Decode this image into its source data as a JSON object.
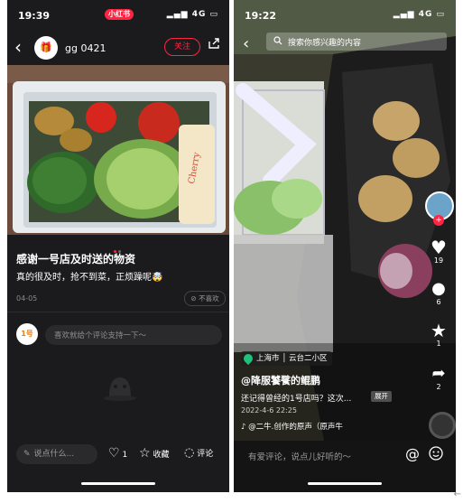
{
  "left": {
    "status_time": "19:39",
    "status_signal": "4G",
    "app_badge": "小红书",
    "username": "gg 0421",
    "follow_label": "关注",
    "post_title": "感谢一号店及时送的物资",
    "post_desc": "真的很及时，抢不到菜，正烦躁呢🤯",
    "post_date": "04-05",
    "dislike_label": "不喜欢",
    "comment_placeholder": "喜欢就给个评论支持一下～",
    "say_placeholder": "说点什么...",
    "like_count": "1",
    "collect_label": "收藏",
    "comment_label": "评论"
  },
  "right": {
    "status_time": "19:22",
    "status_signal": "4G",
    "search_placeholder": "搜索你感兴趣的内容",
    "likes": "19",
    "comments": "6",
    "favorites": "1",
    "shares": "2",
    "location": "上海市 │ 云台二小区",
    "author": "@降服饕餮的鲲鹏",
    "description": "还记得曾经的1号店吗？这次...",
    "expand_label": "展开",
    "date": "2022-4-6 22:25",
    "music": "@二牛.创作的原声（原声牛",
    "comment_placeholder": "有爱评论，说点儿好听的～",
    "at_symbol": "@"
  },
  "colors": {
    "accent": "#ff2442",
    "dark_bg": "#1b1b1d",
    "location_green": "#1fc27b"
  },
  "icons": [
    "back-icon",
    "share-icon",
    "heart-icon",
    "star-icon",
    "comment-icon",
    "search-icon",
    "location-pin-icon",
    "music-icon",
    "emoji-icon",
    "plus-icon"
  ]
}
